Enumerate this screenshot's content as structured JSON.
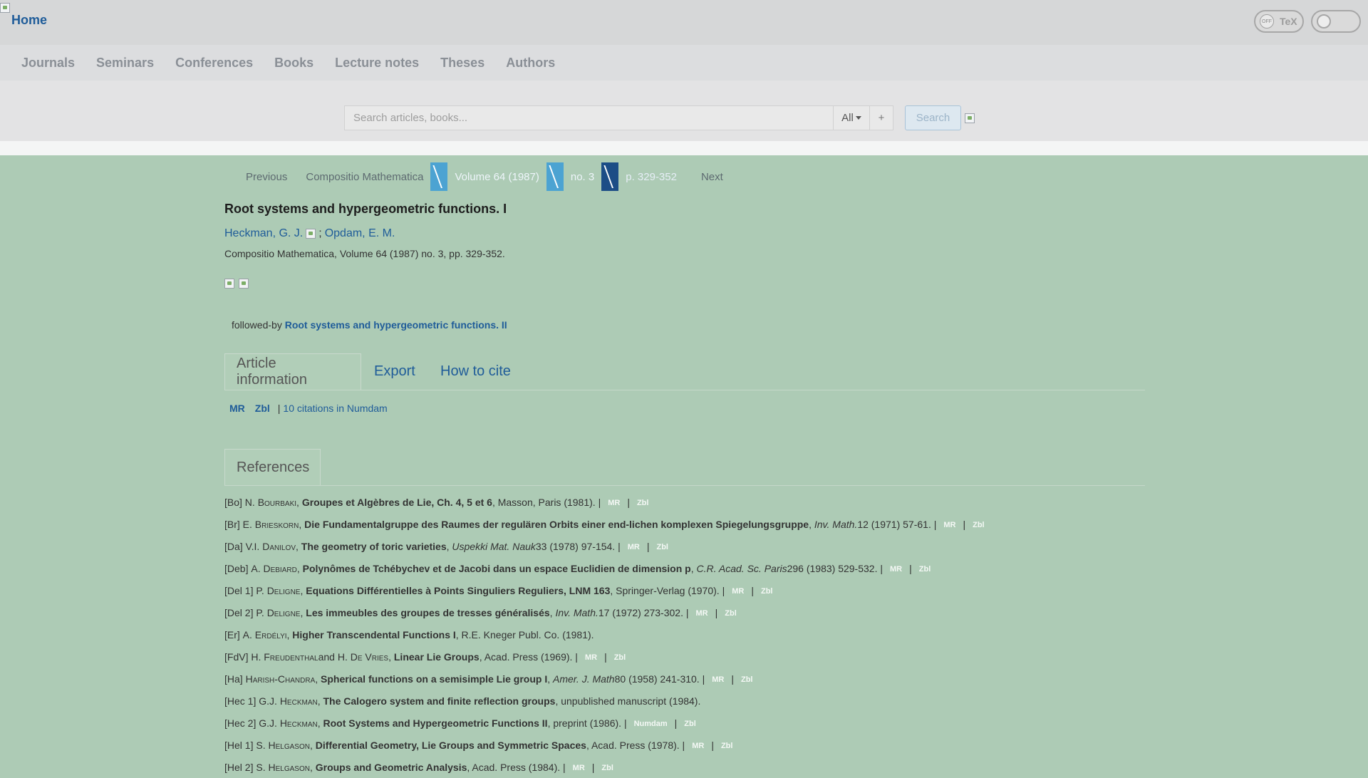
{
  "header": {
    "home_label": "Home",
    "tex_toggle": {
      "state": "OFF",
      "label": "TeX"
    }
  },
  "nav": {
    "items": [
      "Journals",
      "Seminars",
      "Conferences",
      "Books",
      "Lecture notes",
      "Theses",
      "Authors"
    ]
  },
  "search": {
    "placeholder": "Search articles, books...",
    "scope": "All",
    "plus": "+",
    "button": " Search"
  },
  "breadcrumb": {
    "previous": "Previous",
    "journal": "Compositio Mathematica",
    "volume": "Volume 64 (1987)",
    "issue": "no. 3",
    "pages": "p. 329-352",
    "next": "Next"
  },
  "article": {
    "title": "Root systems and hypergeometric functions. I",
    "authors": [
      "Heckman, G. J.",
      "Opdam, E. M."
    ],
    "author_sep": ";",
    "publication": "Compositio Mathematica, Volume 64 (1987) no. 3, pp. 329-352.",
    "followed_by_label": " followed-by",
    "followed_by_title": "Root systems and hypergeometric functions. II"
  },
  "tabs": {
    "info": "Article information",
    "export": "Export",
    "cite": "How to cite",
    "references": "References"
  },
  "citations": {
    "mr": "MR",
    "zbl": "Zbl",
    "sep": "|",
    "numdam": "10 citations in Numdam"
  },
  "references": [
    {
      "key": "[Bo]",
      "pre": "N.",
      "author": "Bourbaki",
      "mid": "",
      "author2": "",
      "title": "Groupes et Algèbres de Lie, Ch. 4, 5 et 6",
      "journal": "",
      "rest": ", Masson, Paris (1981). |",
      "links": [
        "MR",
        "Zbl"
      ]
    },
    {
      "key": "[Br]",
      "pre": "E.",
      "author": "Brieskorn",
      "mid": "",
      "author2": "",
      "title": "Die Fundamentalgruppe des Raumes der regulären Orbits einer end-lichen komplexen Spiegelungsgruppe",
      "journal": "Inv. Math.",
      "rest": " 12 (1971) 57-61. |",
      "links": [
        "MR",
        "Zbl"
      ]
    },
    {
      "key": "[Da]",
      "pre": "V.I.",
      "author": "Danilov",
      "mid": "",
      "author2": "",
      "title": "The geometry of toric varieties",
      "journal": "Uspekki Mat. Nauk",
      "rest": " 33 (1978) 97-154. |",
      "links": [
        "MR",
        "Zbl"
      ]
    },
    {
      "key": "[Deb]",
      "pre": "A.",
      "author": "Debiard",
      "mid": "",
      "author2": "",
      "title": "Polynômes de Tchébychev et de Jacobi dans un espace Euclidien de dimension p",
      "journal": "C.R. Acad. Sc. Paris",
      "rest": " 296 (1983) 529-532. |",
      "links": [
        "MR",
        "Zbl"
      ]
    },
    {
      "key": "[Del 1]",
      "pre": "P.",
      "author": "Deligne",
      "mid": "",
      "author2": "",
      "title": "Equations Différentielles à Points Singuliers Reguliers, LNM 163",
      "journal": "",
      "rest": ", Springer-Verlag (1970). |",
      "links": [
        "MR",
        "Zbl"
      ]
    },
    {
      "key": "[Del 2]",
      "pre": "P.",
      "author": "Deligne",
      "mid": "",
      "author2": "",
      "title": "Les immeubles des groupes de tresses généralisés",
      "journal": "Inv. Math.",
      "rest": " 17 (1972) 273-302. |",
      "links": [
        "MR",
        "Zbl"
      ]
    },
    {
      "key": "[Er]",
      "pre": "A.",
      "author": "Erdélyi",
      "mid": "",
      "author2": "",
      "title": "Higher Transcendental Functions I",
      "journal": "",
      "rest": ", R.E. Kneger Publ. Co. (1981).",
      "links": []
    },
    {
      "key": "[FdV]",
      "pre": "H.",
      "author": "Freudenthal",
      "mid": " and H.",
      "author2": "De Vries",
      "title": "Linear Lie Groups",
      "journal": "",
      "rest": ", Acad. Press (1969). |",
      "links": [
        "MR",
        "Zbl"
      ]
    },
    {
      "key": "[Ha]",
      "pre": "",
      "author": "Harish-Chandra",
      "mid": "",
      "author2": "",
      "title": "Spherical functions on a semisimple Lie group I",
      "journal": "Amer. J. Math",
      "rest": " 80 (1958) 241-310. |",
      "links": [
        "MR",
        "Zbl"
      ]
    },
    {
      "key": "[Hec 1]",
      "pre": "G.J.",
      "author": "Heckman",
      "mid": "",
      "author2": "",
      "title": "The Calogero system and finite reflection groups",
      "journal": "",
      "rest": ", unpublished manuscript (1984).",
      "links": []
    },
    {
      "key": "[Hec 2]",
      "pre": "G.J.",
      "author": "Heckman",
      "mid": "",
      "author2": "",
      "title": "Root Systems and Hypergeometric Functions II",
      "journal": "",
      "rest": ", preprint (1986). |",
      "links": [
        "Numdam",
        "Zbl"
      ]
    },
    {
      "key": "[Hel 1]",
      "pre": "S.",
      "author": "Helgason",
      "mid": "",
      "author2": "",
      "title": "Differential Geometry, Lie Groups and Symmetric Spaces",
      "journal": "",
      "rest": ", Acad. Press (1978). |",
      "links": [
        "MR",
        "Zbl"
      ]
    },
    {
      "key": "[Hel 2]",
      "pre": "S.",
      "author": "Helgason",
      "mid": "",
      "author2": "",
      "title": "Groups and Geometric Analysis",
      "journal": "",
      "rest": ", Acad. Press (1984). |",
      "links": [
        "MR",
        "Zbl"
      ]
    }
  ]
}
